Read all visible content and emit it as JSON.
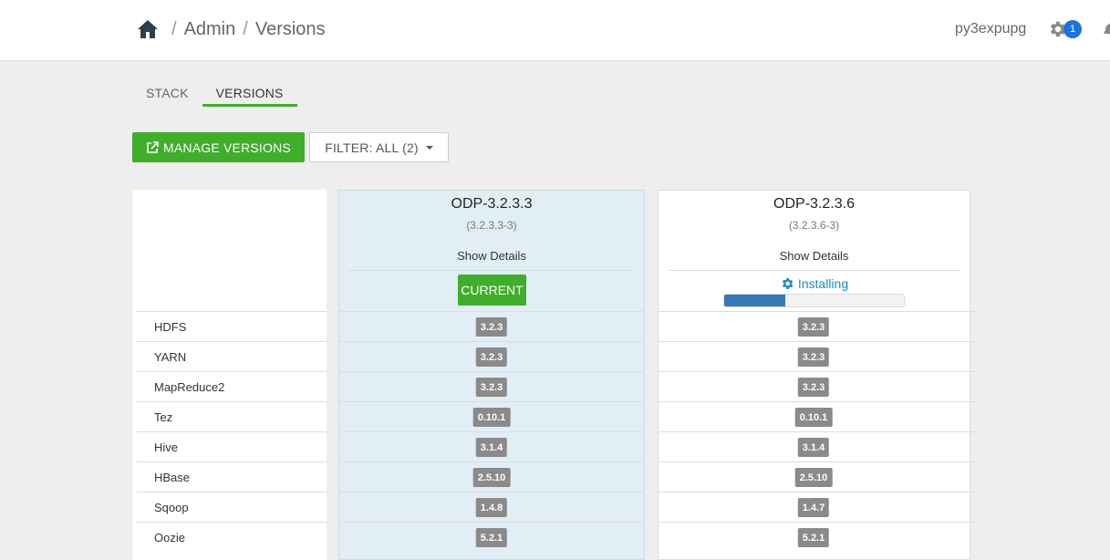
{
  "header": {
    "breadcrumb": [
      "Admin",
      "Versions"
    ],
    "user": "py3expupg",
    "alerts_count": "1"
  },
  "tabs": [
    {
      "label": "STACK",
      "active": false
    },
    {
      "label": "VERSIONS",
      "active": true
    }
  ],
  "toolbar": {
    "manage_label": "MANAGE VERSIONS",
    "filter_label": "FILTER: ALL (2)"
  },
  "versions": [
    {
      "name": "ODP-3.2.3.3",
      "build": "(3.2.3.3-3)",
      "details": "Show Details",
      "status": "CURRENT"
    },
    {
      "name": "ODP-3.2.3.6",
      "build": "(3.2.3.6-3)",
      "details": "Show Details",
      "status": "Installing",
      "progress": 0.34
    }
  ],
  "services": [
    {
      "name": "HDFS",
      "v1": "3.2.3",
      "v2": "3.2.3"
    },
    {
      "name": "YARN",
      "v1": "3.2.3",
      "v2": "3.2.3"
    },
    {
      "name": "MapReduce2",
      "v1": "3.2.3",
      "v2": "3.2.3"
    },
    {
      "name": "Tez",
      "v1": "0.10.1",
      "v2": "0.10.1"
    },
    {
      "name": "Hive",
      "v1": "3.1.4",
      "v2": "3.1.4"
    },
    {
      "name": "HBase",
      "v1": "2.5.10",
      "v2": "2.5.10"
    },
    {
      "name": "Sqoop",
      "v1": "1.4.8",
      "v2": "1.4.7"
    },
    {
      "name": "Oozie",
      "v1": "5.2.1",
      "v2": "5.2.1"
    }
  ],
  "colors": {
    "accent": "#3fae2a",
    "badge": "#1a73d9",
    "installing": "#1e8bc3",
    "progress": "#337ab7"
  }
}
